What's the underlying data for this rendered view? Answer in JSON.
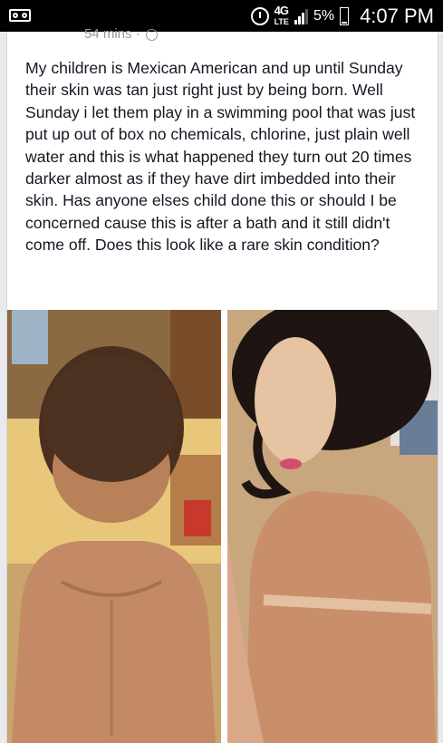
{
  "status_bar": {
    "network": "4G",
    "network_sub": "LTE",
    "battery_pct": "5%",
    "time": "4:07 PM",
    "icons": [
      "voicemail-icon",
      "alarm-icon",
      "signal-icon",
      "battery-icon"
    ]
  },
  "post": {
    "timestamp": "54 mins ·",
    "text": "My children is Mexican American and up until Sunday their skin was tan just right just by being born. Well Sunday i let them play in a swimming pool that was just put up out of box no chemicals, chlorine, just plain well water and this is what happened they turn out 20 times darker almost as if they have dirt imbedded into their skin. Has anyone elses child done this or should I be concerned cause this is after a bath and it still didn't come off. Does this look like a rare skin condition?",
    "photos": [
      {
        "description_icon": "child-back-photo-1"
      },
      {
        "description_icon": "child-back-photo-2"
      }
    ]
  },
  "colors": {
    "text": "#141823",
    "meta": "#9197a3",
    "background": "#e9eaed"
  }
}
